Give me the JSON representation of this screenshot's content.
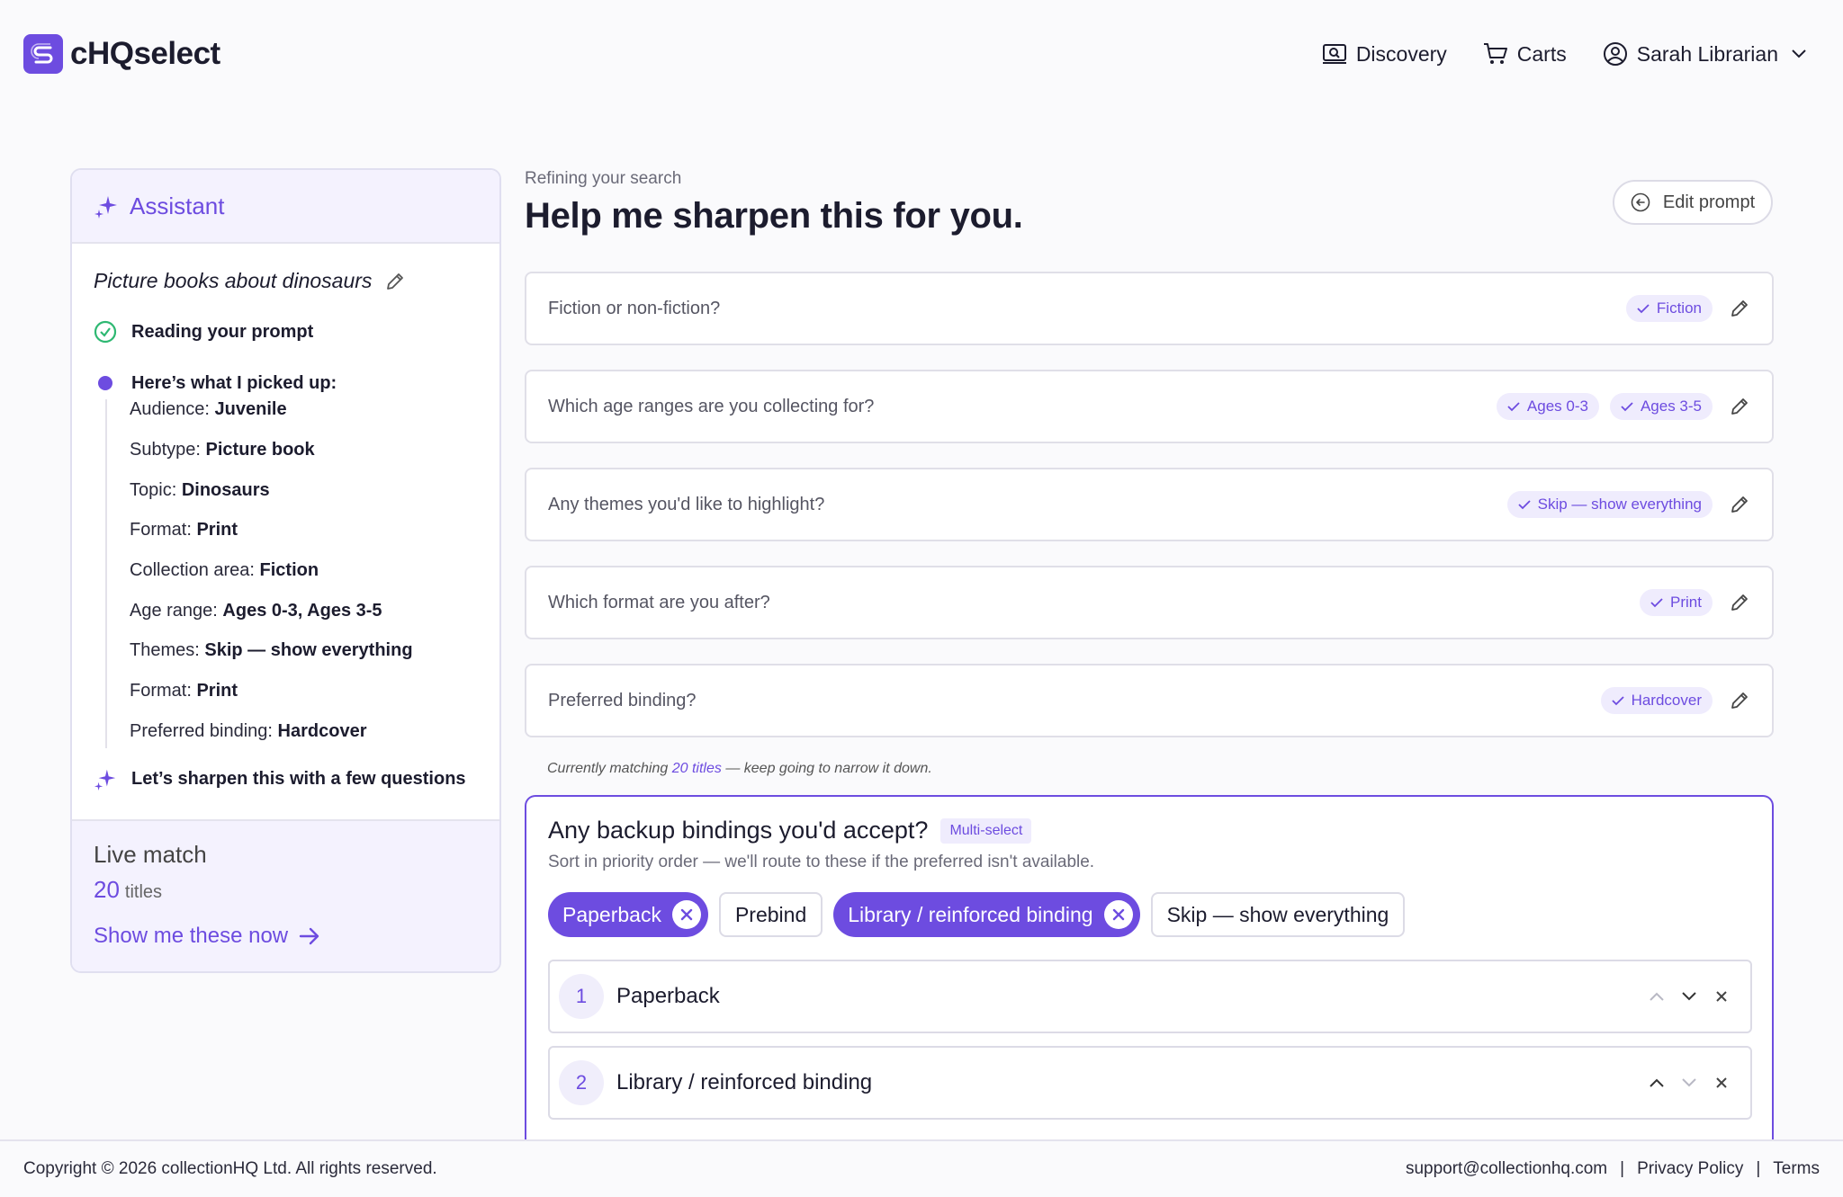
{
  "header": {
    "logo_text": "cHQselect",
    "nav": {
      "discovery": "Discovery",
      "carts": "Carts",
      "user": "Sarah Librarian"
    }
  },
  "assistant": {
    "title": "Assistant",
    "prompt": "Picture books about dinosaurs",
    "steps": {
      "reading": "Reading your prompt",
      "picked": "Here’s what I picked up:",
      "sharpen": "Let’s sharpen this with a few questions"
    },
    "picked_items": [
      {
        "label": "Audience:",
        "value": "Juvenile"
      },
      {
        "label": "Subtype:",
        "value": "Picture book"
      },
      {
        "label": "Topic:",
        "value": "Dinosaurs"
      },
      {
        "label": "Format:",
        "value": "Print"
      },
      {
        "label": "Collection area:",
        "value": "Fiction"
      },
      {
        "label": "Age range:",
        "value": "Ages 0-3, Ages 3-5"
      },
      {
        "label": "Themes:",
        "value": "Skip — show everything"
      },
      {
        "label": "Format:",
        "value": "Print"
      },
      {
        "label": "Preferred binding:",
        "value": "Hardcover"
      }
    ],
    "live_match": {
      "title": "Live match",
      "count": "20",
      "unit": "titles",
      "link": "Show me these now"
    }
  },
  "main": {
    "eyebrow": "Refining your search",
    "title": "Help me sharpen this for you.",
    "edit_prompt": "Edit prompt",
    "questions": [
      {
        "text": "Fiction or non-fiction?",
        "answers": [
          "Fiction"
        ]
      },
      {
        "text": "Which age ranges are you collecting for?",
        "answers": [
          "Ages 0-3",
          "Ages 3-5"
        ]
      },
      {
        "text": "Any themes you'd like to highlight?",
        "answers": [
          "Skip — show everything"
        ]
      },
      {
        "text": "Which format are you after?",
        "answers": [
          "Print"
        ]
      },
      {
        "text": "Preferred binding?",
        "answers": [
          "Hardcover"
        ]
      }
    ],
    "matching": {
      "prefix": "Currently matching",
      "count_text": "20 titles",
      "suffix": "— keep going to narrow it down."
    },
    "active_question": {
      "text": "Any backup bindings you'd accept?",
      "badge": "Multi-select",
      "subtitle": "Sort in priority order — we'll route to these if the preferred isn't available.",
      "options": {
        "paperback": "Paperback",
        "prebind": "Prebind",
        "library": "Library / reinforced binding",
        "skip": "Skip — show everything"
      },
      "ranked": [
        {
          "num": "1",
          "label": "Paperback"
        },
        {
          "num": "2",
          "label": "Library / reinforced binding"
        }
      ]
    }
  },
  "footer": {
    "copyright": "Copyright © 2026 collectionHQ Ltd. All rights reserved.",
    "email": "support@collectionhq.com",
    "privacy": "Privacy Policy",
    "terms": "Terms",
    "sep": "|"
  },
  "colors": {
    "accent": "#6d4ce0",
    "accent_soft": "#efecfd",
    "success": "#2eb872",
    "border": "#e0dfe8"
  }
}
